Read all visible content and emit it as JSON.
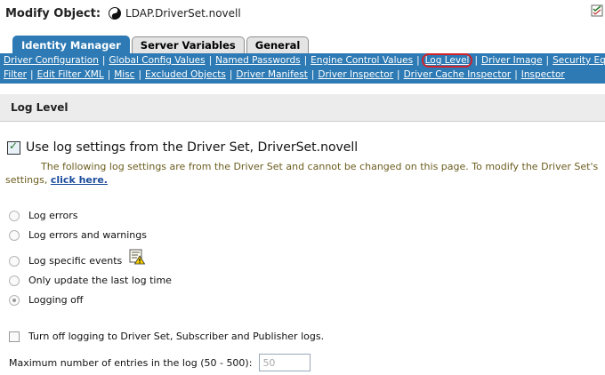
{
  "header": {
    "title": "Modify Object:",
    "object_name": "LDAP.DriverSet.novell",
    "object_icon": "yin-yang-icon",
    "help_icon": "edit-help-icon"
  },
  "tabs": [
    {
      "label": "Identity Manager",
      "active": true
    },
    {
      "label": "Server Variables",
      "active": false
    },
    {
      "label": "General",
      "active": false
    }
  ],
  "subnav": {
    "row1": [
      "Driver Configuration",
      "Global Config Values",
      "Named Passwords",
      "Engine Control Values",
      "Log Level",
      "Driver Image",
      "Security Equals"
    ],
    "row2": [
      "Filter",
      "Edit Filter XML",
      "Misc",
      "Excluded Objects",
      "Driver Manifest",
      "Driver Inspector",
      "Driver Cache Inspector",
      "Inspector"
    ],
    "selected": "Log Level",
    "separator": "|"
  },
  "section": {
    "title": "Log Level"
  },
  "use_driver_set": {
    "label": "Use log settings from the Driver Set, DriverSet.novell",
    "checked": true,
    "info_line1": "The following log settings are from the Driver Set and cannot be changed on this page. To modify the Driver Set's",
    "info_line2": "settings,",
    "link": "click here."
  },
  "log_options": [
    {
      "label": "Log errors",
      "selected": false
    },
    {
      "label": "Log errors and warnings",
      "selected": false
    },
    {
      "label": "Log specific events",
      "selected": false,
      "icon": "warning-note-icon"
    },
    {
      "label": "Only update the last log time",
      "selected": false
    },
    {
      "label": "Logging off",
      "selected": true
    }
  ],
  "turn_off": {
    "label": "Turn off logging to Driver Set, Subscriber and Publisher logs.",
    "checked": false
  },
  "max_entries": {
    "label": "Maximum number of entries in the log (50 - 500):",
    "value": "50"
  },
  "colors": {
    "nav_blue": "#2d7ab4",
    "highlight": "#d2232a",
    "info_text": "#6b5d1e",
    "link": "#1a4c9b"
  }
}
